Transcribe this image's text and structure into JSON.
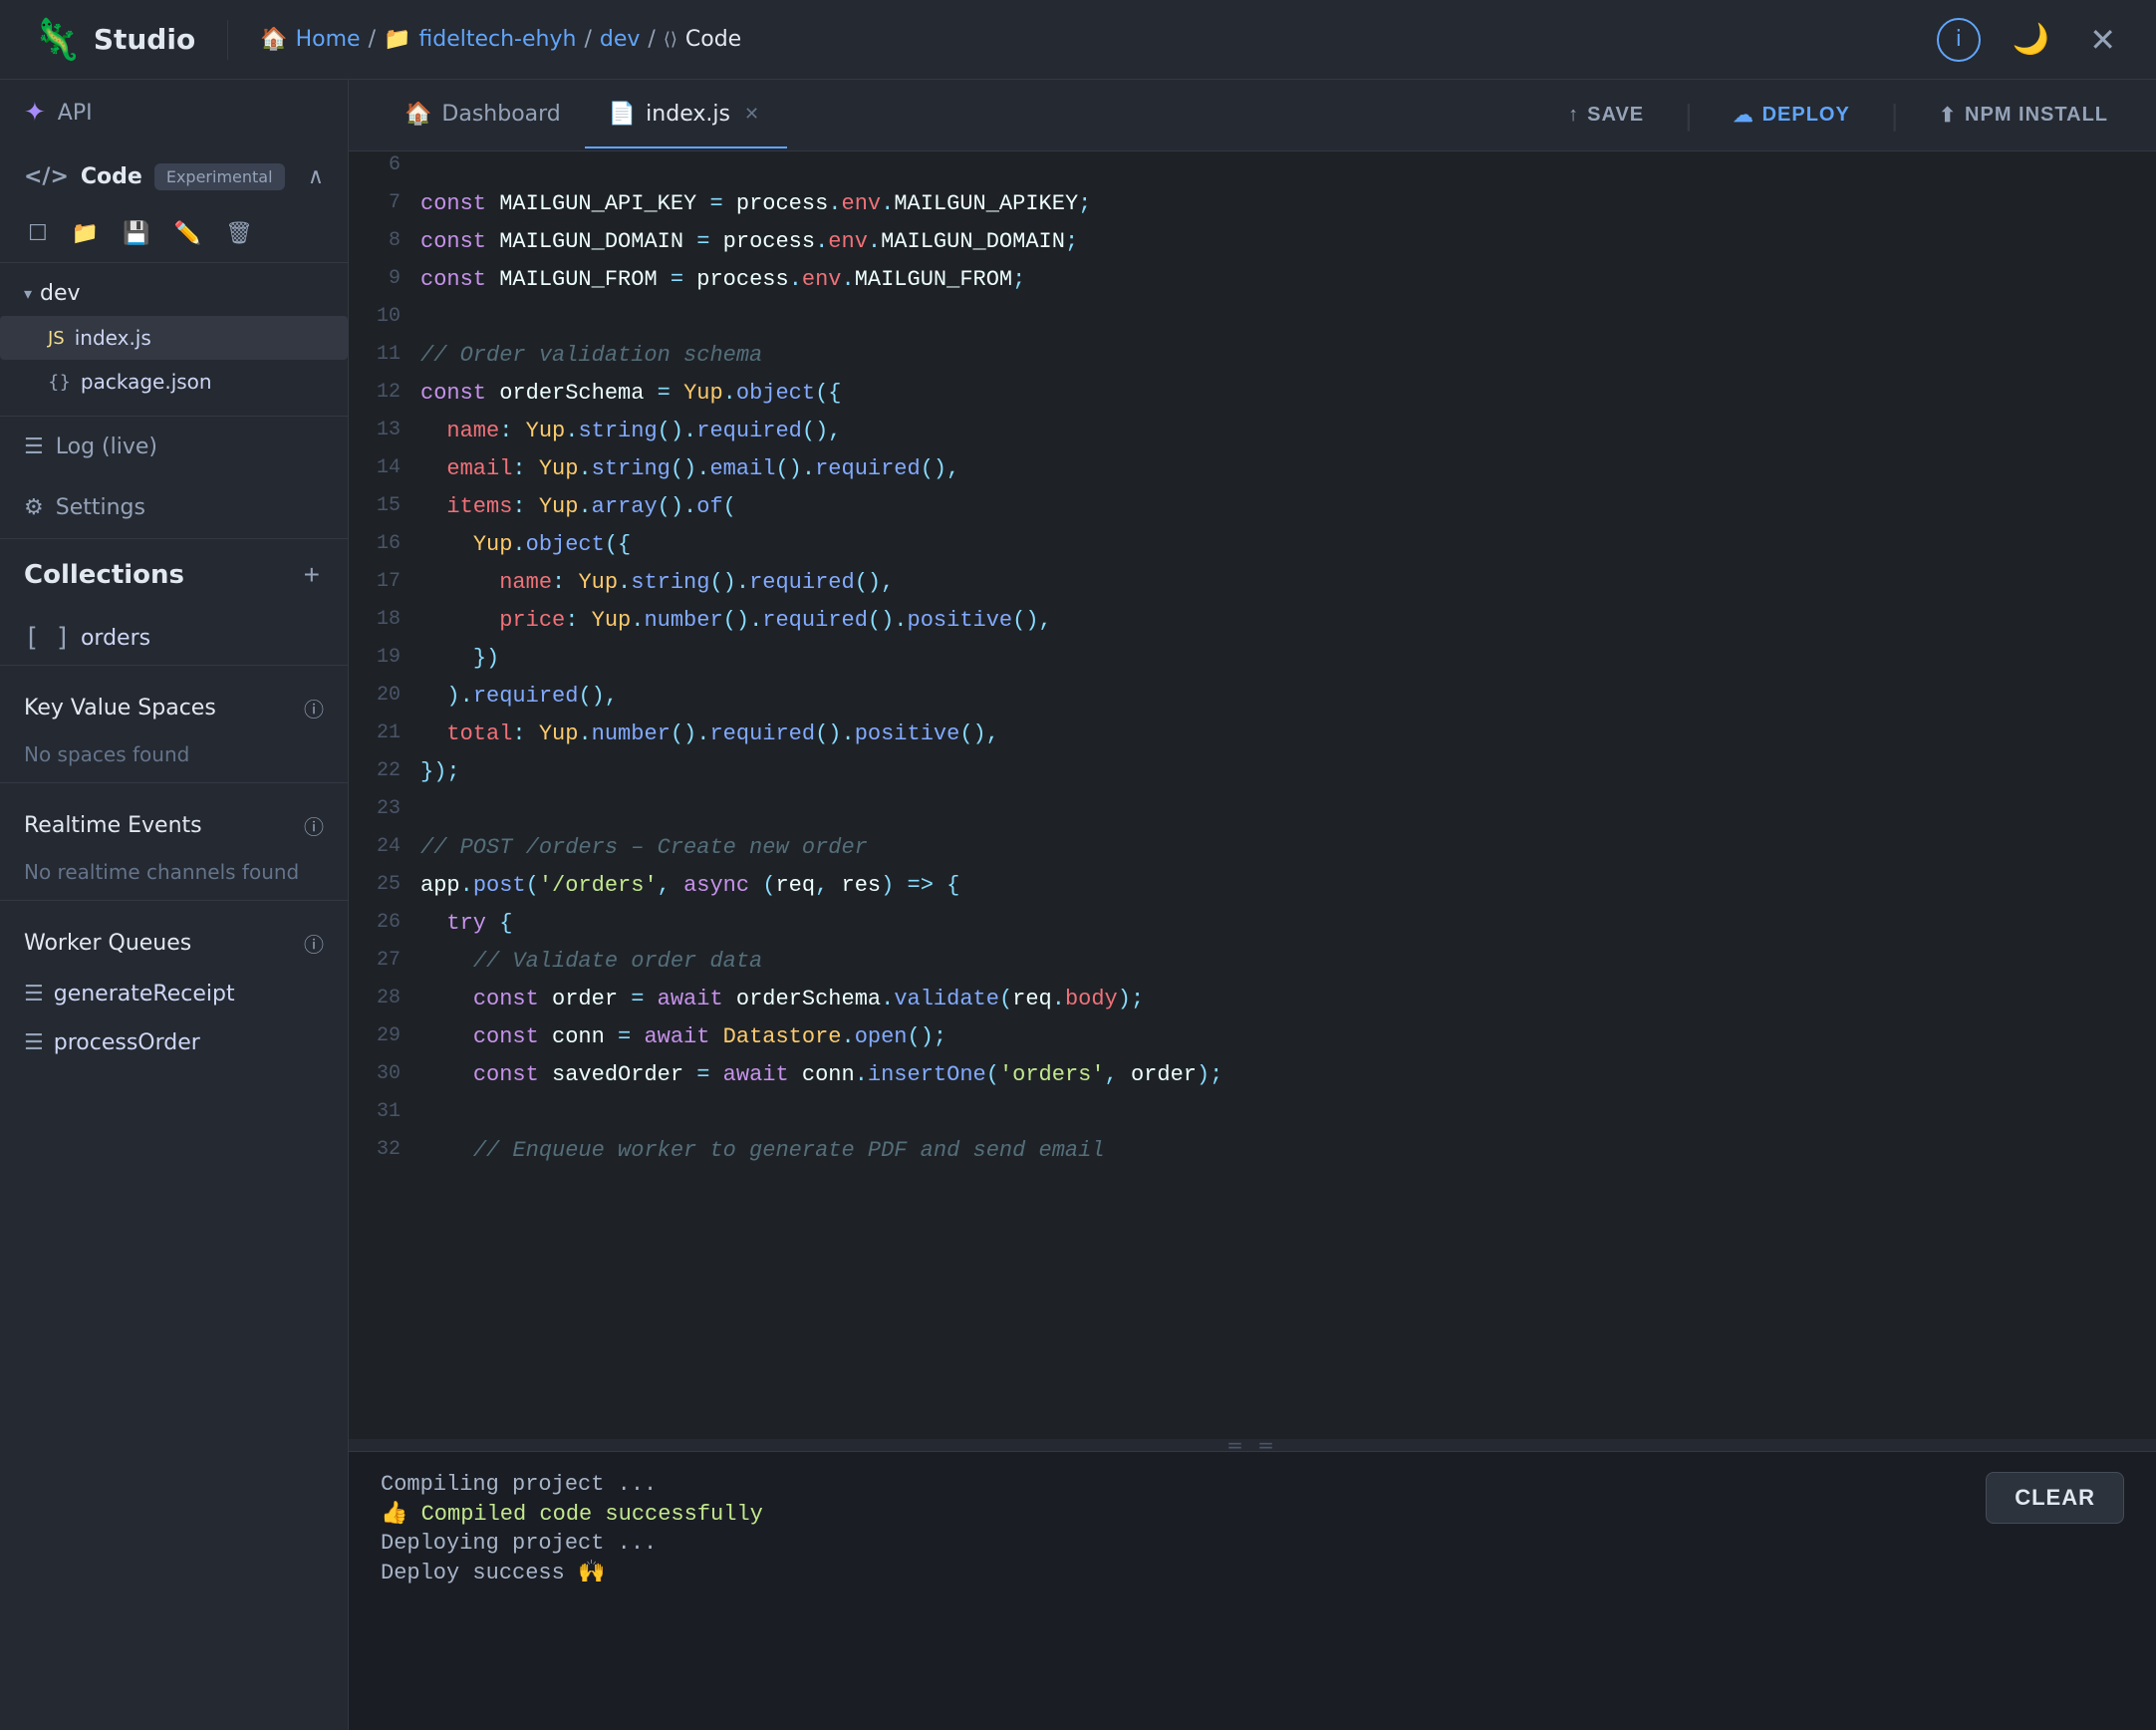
{
  "app": {
    "name": "Studio",
    "logo_emoji": "🦎"
  },
  "breadcrumb": {
    "home": "Home",
    "org": "fideltech-ehyh",
    "branch": "dev",
    "section": "Code"
  },
  "header": {
    "save_label": "SAVE",
    "deploy_label": "DEPLOY",
    "npm_label": "NPM INSTALL"
  },
  "sidebar": {
    "api_label": "API",
    "code_label": "Code",
    "experimental_label": "Experimental",
    "log_label": "Log (live)",
    "settings_label": "Settings",
    "collections_label": "Collections",
    "collections_add_icon": "+",
    "orders_label": "orders",
    "key_value_spaces_label": "Key Value Spaces",
    "no_spaces_label": "No spaces found",
    "realtime_events_label": "Realtime Events",
    "no_realtime_label": "No realtime channels found",
    "worker_queues_label": "Worker Queues",
    "workers": [
      {
        "label": "generateReceipt"
      },
      {
        "label": "processOrder"
      }
    ],
    "dev_label": "dev",
    "files": [
      {
        "name": "index.js",
        "type": "js",
        "active": true
      },
      {
        "name": "package.json",
        "type": "json",
        "active": false
      }
    ]
  },
  "tabs": [
    {
      "label": "Dashboard",
      "icon": "🏠",
      "active": false,
      "closable": false
    },
    {
      "label": "index.js",
      "icon": "📄",
      "active": true,
      "closable": true
    }
  ],
  "code": {
    "lines": [
      {
        "num": "6",
        "content": ""
      },
      {
        "num": "7",
        "content": "const MAILGUN_API_KEY = process.env.MAILGUN_APIKEY;"
      },
      {
        "num": "8",
        "content": "const MAILGUN_DOMAIN = process.env.MAILGUN_DOMAIN;"
      },
      {
        "num": "9",
        "content": "const MAILGUN_FROM = process.env.MAILGUN_FROM;"
      },
      {
        "num": "10",
        "content": ""
      },
      {
        "num": "11",
        "content": "// Order validation schema"
      },
      {
        "num": "12",
        "content": "const orderSchema = Yup.object({"
      },
      {
        "num": "13",
        "content": "  name: Yup.string().required(),"
      },
      {
        "num": "14",
        "content": "  email: Yup.string().email().required(),"
      },
      {
        "num": "15",
        "content": "  items: Yup.array().of("
      },
      {
        "num": "16",
        "content": "    Yup.object({"
      },
      {
        "num": "17",
        "content": "      name: Yup.string().required(),"
      },
      {
        "num": "18",
        "content": "      price: Yup.number().required().positive(),"
      },
      {
        "num": "19",
        "content": "    })"
      },
      {
        "num": "20",
        "content": "  ).required(),"
      },
      {
        "num": "21",
        "content": "  total: Yup.number().required().positive(),"
      },
      {
        "num": "22",
        "content": "});"
      },
      {
        "num": "23",
        "content": ""
      },
      {
        "num": "24",
        "content": "// POST /orders – Create new order"
      },
      {
        "num": "25",
        "content": "app.post('/orders', async (req, res) => {"
      },
      {
        "num": "26",
        "content": "  try {"
      },
      {
        "num": "27",
        "content": "    // Validate order data"
      },
      {
        "num": "28",
        "content": "    const order = await orderSchema.validate(req.body);"
      },
      {
        "num": "29",
        "content": "    const conn = await Datastore.open();"
      },
      {
        "num": "30",
        "content": "    const savedOrder = await conn.insertOne('orders', order);"
      },
      {
        "num": "31",
        "content": ""
      },
      {
        "num": "32",
        "content": "    // Enqueue worker to generate PDF and send email"
      }
    ]
  },
  "terminal": {
    "lines": [
      {
        "text": "Compiling project ...",
        "type": "normal"
      },
      {
        "text": "👍 Compiled code successfully",
        "type": "success"
      },
      {
        "text": "Deploying project ...",
        "type": "normal"
      },
      {
        "text": "Deploy success 🙌",
        "type": "normal"
      }
    ],
    "clear_label": "CLEAR"
  }
}
